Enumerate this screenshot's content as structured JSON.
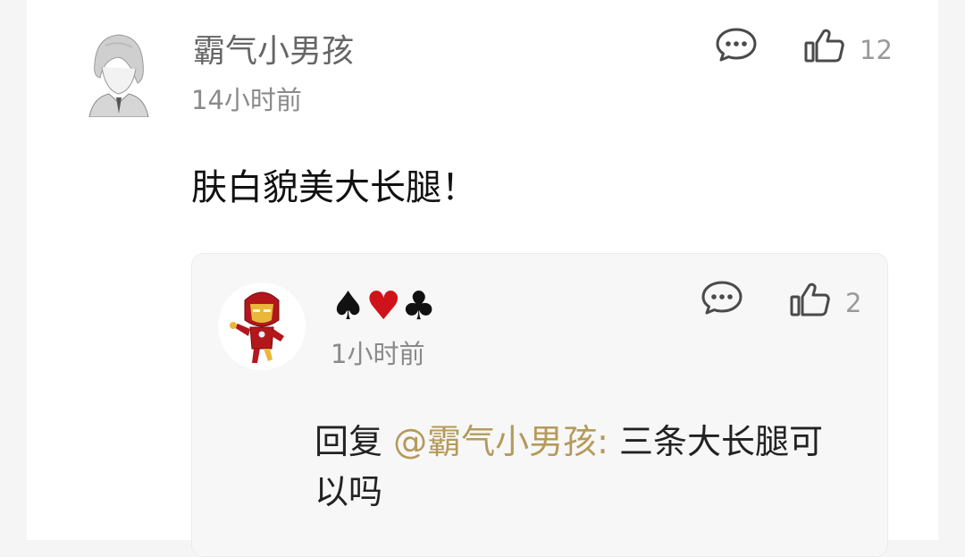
{
  "comment": {
    "username": "霸气小男孩",
    "time": "14小时前",
    "text": "肤白貌美大长腿！",
    "like_count": "12",
    "icons": {
      "reply": "comment-bubble-icon",
      "like": "thumbs-up-icon"
    }
  },
  "reply": {
    "username_suits": [
      "♠",
      "♥",
      "♣"
    ],
    "time": "1小时前",
    "prefix": "回复 ",
    "mention": "@霸气小男孩:",
    "text": " 三条大长腿可以吗",
    "like_count": "2",
    "icons": {
      "reply": "comment-bubble-icon",
      "like": "thumbs-up-icon"
    }
  },
  "colors": {
    "mention": "#b59a5a",
    "heart": "#d0131a",
    "background": "#f5f5f5",
    "card": "#ffffff"
  }
}
